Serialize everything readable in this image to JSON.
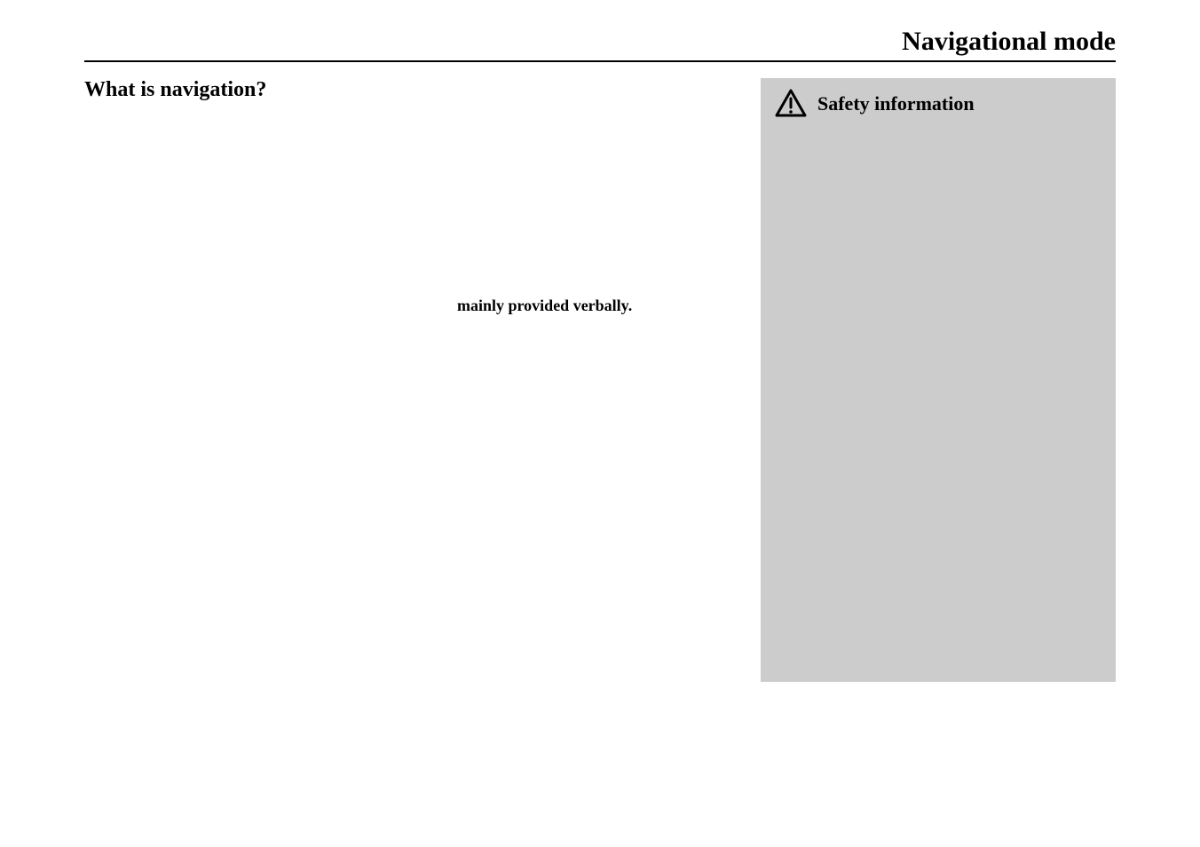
{
  "header": {
    "title": "Navigational mode"
  },
  "main": {
    "heading": "What is navigation?",
    "bold_phrase": "mainly provided verbally."
  },
  "sidebar": {
    "title": "Safety information"
  }
}
